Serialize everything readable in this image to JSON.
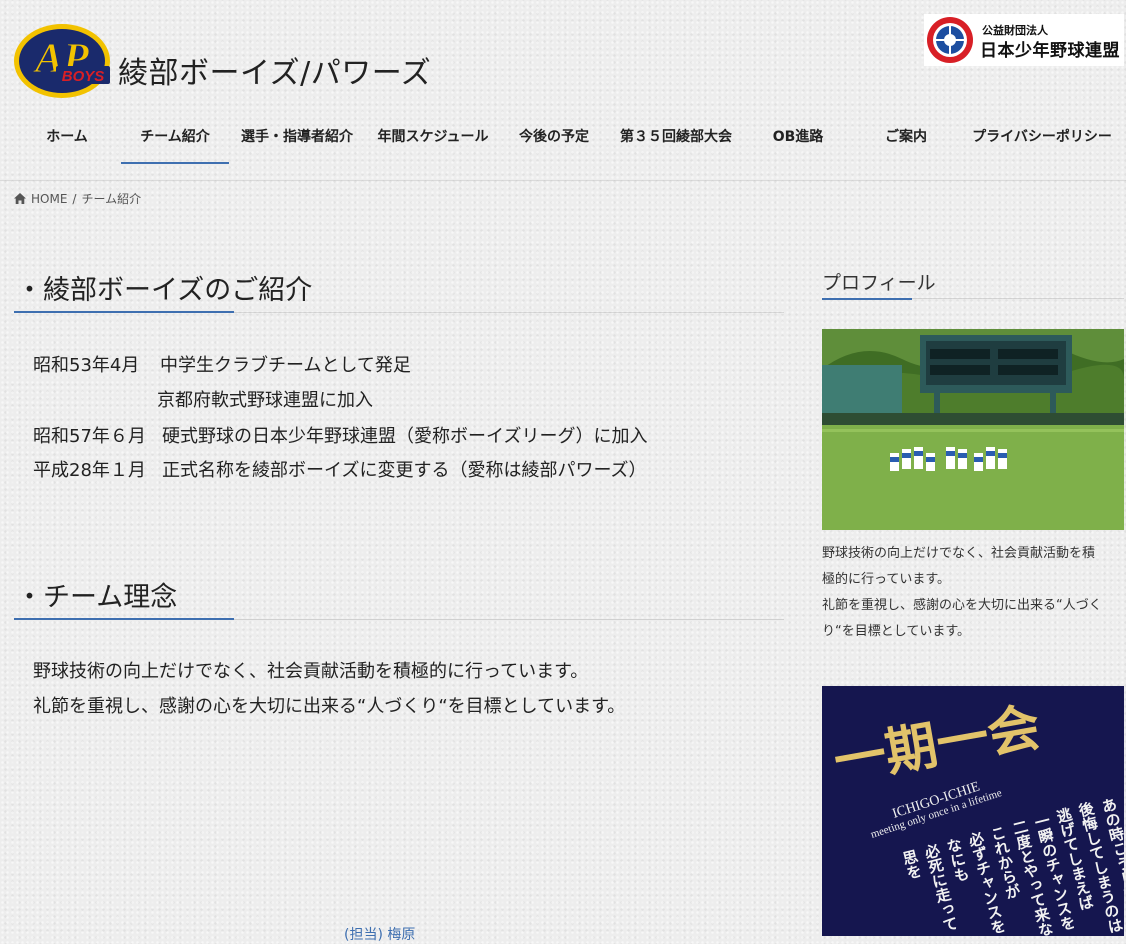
{
  "header": {
    "logo_text": "AP",
    "logo_sub": "BOYS",
    "site_title": "綾部ボーイズ/パワーズ",
    "league_small": "公益財団法人",
    "league_name": "日本少年野球連盟"
  },
  "nav": {
    "items": [
      {
        "label": "ホーム"
      },
      {
        "label": "チーム紹介"
      },
      {
        "label": "選手・指導者紹介"
      },
      {
        "label": "年間スケジュール"
      },
      {
        "label": "今後の予定"
      },
      {
        "label": "第３５回綾部大会"
      },
      {
        "label": "OB進路"
      },
      {
        "label": "ご案内"
      },
      {
        "label": "プライバシーポリシー"
      }
    ],
    "active_index": 1
  },
  "breadcrumb": {
    "home": "HOME",
    "separator": "/",
    "current": "チーム紹介"
  },
  "intro": {
    "title": "・綾部ボーイズのご紹介",
    "lines": [
      {
        "date": "昭和53年4月",
        "text": "中学生クラブチームとして発足"
      },
      {
        "date": "",
        "text": "京都府軟式野球連盟に加入"
      },
      {
        "date": "昭和57年６月",
        "text": "硬式野球の日本少年野球連盟（愛称ボーイズリーグ）に加入"
      },
      {
        "date": "平成28年１月",
        "text": "正式名称を綾部ボーイズに変更する（愛称は綾部パワーズ）"
      }
    ]
  },
  "philosophy": {
    "title": "・チーム理念",
    "lines": [
      "野球技術の向上だけでなく、社会貢献活動を積極的に行っています。",
      "礼節を重視し、感謝の心を大切に出来る“人づくり“を目標としています。"
    ]
  },
  "sidebar": {
    "profile_title": "プロフィール",
    "profile_lines": [
      "野球技術の向上だけでなく、社会貢献活動を積",
      "極的に行っています。",
      "礼節を重視し、感謝の心を大切に出来る“人づく",
      "り“を目標としています。"
    ],
    "shirt_kanji": "一期一会",
    "shirt_romaji": "ICHIGO-ICHIE",
    "shirt_english": "meeting only once in a lifetime",
    "shirt_poem": [
      "あの時こうしていれば",
      "後悔してしまうのは",
      "逃げてしまえば",
      "一瞬のチャンスを",
      "二度とやって来ない",
      "これからが",
      "必ずチャンスを",
      "なにも",
      "必死に走って",
      "思を"
    ]
  },
  "footer": {
    "text": "(担当) 梅原"
  },
  "colors": {
    "accent": "#3e6fb0",
    "logo_navy": "#1a2a6c",
    "logo_gold": "#f2c200",
    "logo_red": "#d81f26"
  }
}
